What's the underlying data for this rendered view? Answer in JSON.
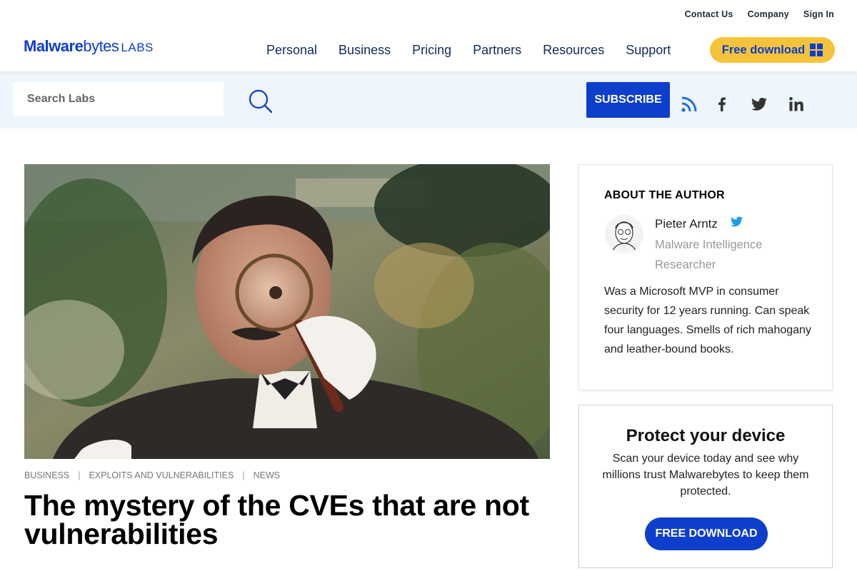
{
  "header": {
    "utility_links": [
      "Contact Us",
      "Company",
      "Sign In"
    ],
    "logo": {
      "brand_bold": "Malware",
      "brand_light": "bytes",
      "suffix": "LABS"
    },
    "nav": [
      "Personal",
      "Business",
      "Pricing",
      "Partners",
      "Resources",
      "Support"
    ],
    "cta_label": "Free download"
  },
  "subbar": {
    "search_placeholder": "Search Labs",
    "subscribe_label": "SUBSCRIBE",
    "social_icons": [
      "rss-icon",
      "facebook-icon",
      "twitter-icon",
      "linkedin-icon"
    ]
  },
  "article": {
    "categories": [
      "BUSINESS",
      "EXPLOITS AND VULNERABILITIES",
      "NEWS"
    ],
    "title": "The mystery of the CVEs that are not vulnerabilities"
  },
  "sidebar": {
    "author": {
      "heading": "ABOUT THE AUTHOR",
      "name": "Pieter Arntz",
      "role": "Malware Intelligence Researcher",
      "bio": "Was a Microsoft MVP in consumer security for 12 years running. Can speak four languages. Smells of rich mahogany and leather-bound books."
    },
    "protect": {
      "title": "Protect your device",
      "text": "Scan your device today and see why millions trust Malwarebytes to keep them protected.",
      "button_label": "FREE DOWNLOAD"
    }
  },
  "colors": {
    "brand_blue": "#0d3ecc",
    "cta_yellow": "#f5c33b",
    "subbar_bg": "#eef5fc",
    "nav_text": "#102a5c"
  }
}
